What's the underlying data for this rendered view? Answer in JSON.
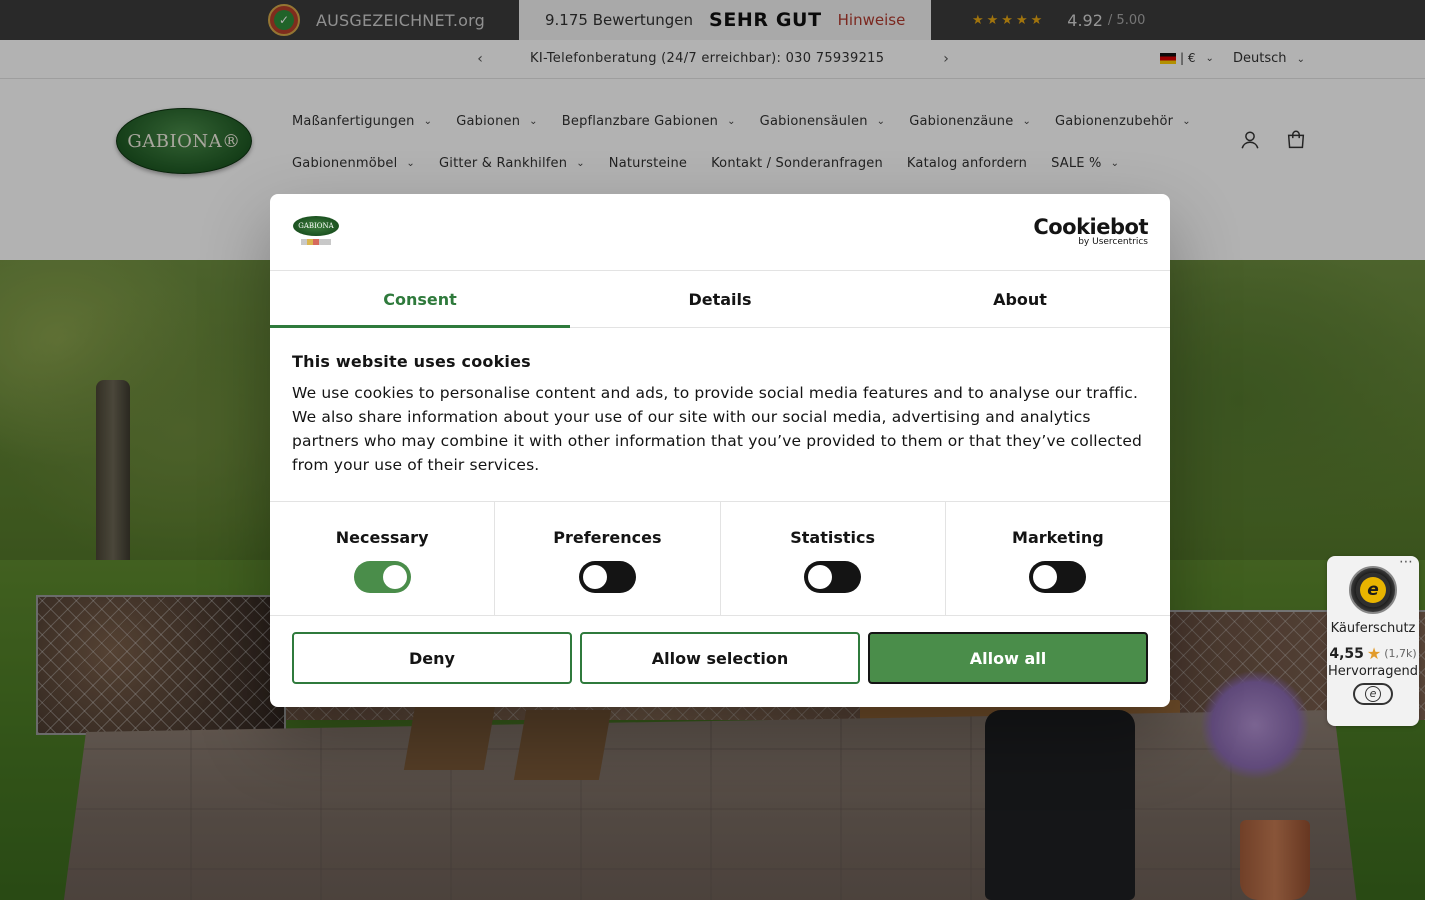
{
  "rating_bar": {
    "award_text": "AUSGEZEICHNET.org",
    "reviews_count": "9.175 Bewertungen",
    "verdict": "SEHR GUT",
    "hint_link": "Hinweise",
    "stars": "★★★★★",
    "score": "4.92",
    "score_max": "/ 5.00"
  },
  "announcement": {
    "message": "KI-Telefonberatung (24/7 erreichbar): 030 75939215",
    "country_currency": "| €",
    "language": "Deutsch"
  },
  "header": {
    "logo_text": "GABIONA®",
    "nav_row1": [
      {
        "label": "Maßanfertigungen",
        "has_menu": true
      },
      {
        "label": "Gabionen",
        "has_menu": true
      },
      {
        "label": "Bepflanzbare Gabionen",
        "has_menu": true
      },
      {
        "label": "Gabionensäulen",
        "has_menu": true
      },
      {
        "label": "Gabionenzäune",
        "has_menu": true
      },
      {
        "label": "Gabionenzubehör",
        "has_menu": true
      }
    ],
    "nav_row2": [
      {
        "label": "Gabionenmöbel",
        "has_menu": true
      },
      {
        "label": "Gitter & Rankhilfen",
        "has_menu": true
      },
      {
        "label": "Natursteine",
        "has_menu": false
      },
      {
        "label": "Kontakt / Sonderanfragen",
        "has_menu": false
      },
      {
        "label": "Katalog anfordern",
        "has_menu": false
      },
      {
        "label": "SALE %",
        "has_menu": true
      }
    ]
  },
  "trusted_badge": {
    "label": "Käuferschutz",
    "score": "4,55",
    "count": "(1,7k)",
    "verdict": "Hervorragend"
  },
  "cookie_dialog": {
    "brand_name": "Cookiebot",
    "brand_by": "by Usercentrics",
    "tabs": [
      "Consent",
      "Details",
      "About"
    ],
    "active_tab": "Consent",
    "title": "This website uses cookies",
    "body": "We use cookies to personalise content and ads, to provide social media features and to analyse our traffic. We also share information about your use of our site with our social media, advertising and analytics partners who may combine it with other information that you’ve provided to them or that they’ve collected from your use of their services.",
    "categories": [
      {
        "label": "Necessary",
        "enabled": true
      },
      {
        "label": "Preferences",
        "enabled": false
      },
      {
        "label": "Statistics",
        "enabled": false
      },
      {
        "label": "Marketing",
        "enabled": false
      }
    ],
    "buttons": {
      "deny": "Deny",
      "allow_selection": "Allow selection",
      "allow_all": "Allow all"
    }
  },
  "colors": {
    "accent_green": "#2f7a3c",
    "button_green": "#4a8d4a",
    "hint_red": "#b03a2e",
    "star_gold": "#e7a614"
  }
}
